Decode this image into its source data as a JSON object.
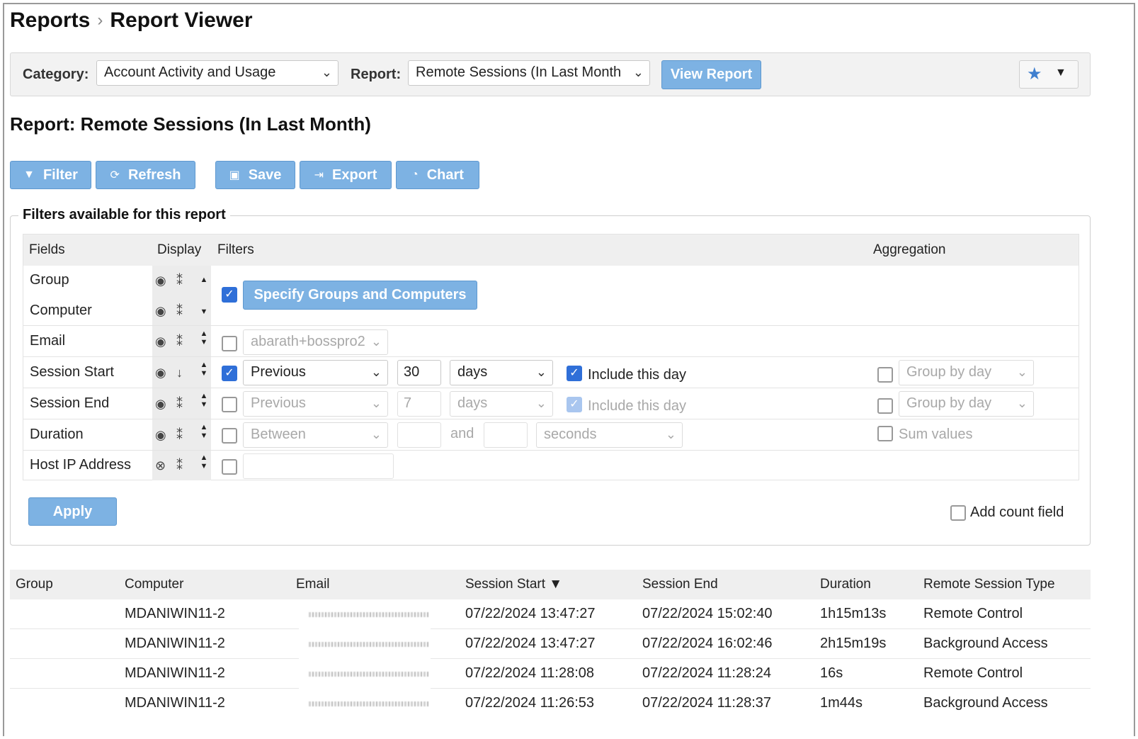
{
  "breadcrumb": {
    "root": "Reports",
    "separator": "›",
    "current": "Report Viewer"
  },
  "toolbar": {
    "category_label": "Category:",
    "category_value": "Account Activity and Usage",
    "report_label": "Report:",
    "report_value": "Remote Sessions (In Last Month",
    "view_report_label": "View Report"
  },
  "report_title": "Report: Remote Sessions (In Last Month)",
  "actions": {
    "filter": "Filter",
    "refresh": "Refresh",
    "save": "Save",
    "export": "Export",
    "chart": "Chart"
  },
  "filters_panel": {
    "legend": "Filters available for this report",
    "headers": {
      "fields": "Fields",
      "display": "Display",
      "filters": "Filters",
      "aggregation": "Aggregation"
    },
    "rows": {
      "group": "Group",
      "computer": "Computer",
      "specify_button": "Specify Groups and Computers",
      "email": "Email",
      "email_value": "abarath+bosspro2",
      "session_start": "Session Start",
      "ss_mode": "Previous",
      "ss_amount": "30",
      "ss_unit": "days",
      "ss_include": "Include this day",
      "ss_group_by": "Group by day",
      "session_end": "Session End",
      "se_mode": "Previous",
      "se_amount": "7",
      "se_unit": "days",
      "se_include": "Include this day",
      "se_group_by": "Group by day",
      "duration": "Duration",
      "du_mode": "Between",
      "du_and": "and",
      "du_unit": "seconds",
      "du_sum": "Sum values",
      "host_ip": "Host IP Address"
    },
    "apply_label": "Apply",
    "add_count_label": "Add count field"
  },
  "results": {
    "headers": [
      "Group",
      "Computer",
      "Email",
      "Session Start ▼",
      "Session End",
      "Duration",
      "Remote Session Type"
    ],
    "rows": [
      {
        "group": "",
        "computer": "MDANIWIN11-2",
        "start": "07/22/2024 13:47:27",
        "end": "07/22/2024 15:02:40",
        "duration": "1h15m13s",
        "type": "Remote Control"
      },
      {
        "group": "",
        "computer": "MDANIWIN11-2",
        "start": "07/22/2024 13:47:27",
        "end": "07/22/2024 16:02:46",
        "duration": "2h15m19s",
        "type": "Background Access"
      },
      {
        "group": "",
        "computer": "MDANIWIN11-2",
        "start": "07/22/2024 11:28:08",
        "end": "07/22/2024 11:28:24",
        "duration": "16s",
        "type": "Remote Control"
      },
      {
        "group": "",
        "computer": "MDANIWIN11-2",
        "start": "07/22/2024 11:26:53",
        "end": "07/22/2024 11:28:37",
        "duration": "1m44s",
        "type": "Background Access"
      }
    ]
  },
  "colors": {
    "accent_button": "#7db2e3",
    "checkbox_on": "#2f6fd8",
    "star": "#3f7fcf"
  },
  "icons": [
    "filter-icon",
    "refresh-icon",
    "save-icon",
    "export-icon",
    "chart-icon",
    "star-icon",
    "eye-icon",
    "eye-off-icon",
    "sort-icon",
    "chevron-down-icon"
  ]
}
